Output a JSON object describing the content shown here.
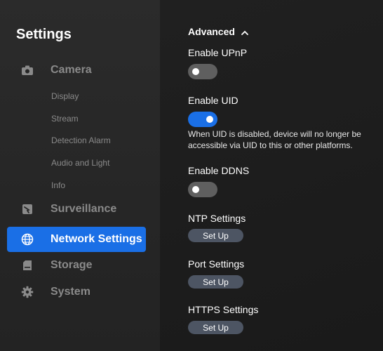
{
  "sidebar": {
    "title": "Settings",
    "camera": {
      "label": "Camera",
      "icon": "camera-icon"
    },
    "camera_subitems": [
      "Display",
      "Stream",
      "Detection Alarm",
      "Audio and Light",
      "Info"
    ],
    "surveillance": {
      "label": "Surveillance",
      "icon": "surveillance-icon"
    },
    "network": {
      "label": "Network Settings",
      "icon": "globe-icon",
      "active": true
    },
    "storage": {
      "label": "Storage",
      "icon": "sd-card-icon"
    },
    "system": {
      "label": "System",
      "icon": "gear-icon"
    }
  },
  "main": {
    "section_title": "Advanced",
    "section_expanded": true,
    "upnp": {
      "label": "Enable UPnP",
      "enabled": false
    },
    "uid": {
      "label": "Enable UID",
      "enabled": true,
      "help": "When UID is disabled, device will no longer be accessible via UID to this or other platforms."
    },
    "ddns": {
      "label": "Enable DDNS",
      "enabled": false
    },
    "ntp": {
      "label": "NTP Settings",
      "button": "Set Up"
    },
    "port": {
      "label": "Port Settings",
      "button": "Set Up"
    },
    "https": {
      "label": "HTTPS Settings",
      "button": "Set Up"
    }
  },
  "colors": {
    "accent": "#1a6fe6",
    "sidebar_bg": "#2b2b2b",
    "main_bg": "#1c1c1c",
    "muted_text": "#8a8a8a",
    "button_bg": "#4d5563",
    "toggle_off": "#5f5f5f"
  }
}
